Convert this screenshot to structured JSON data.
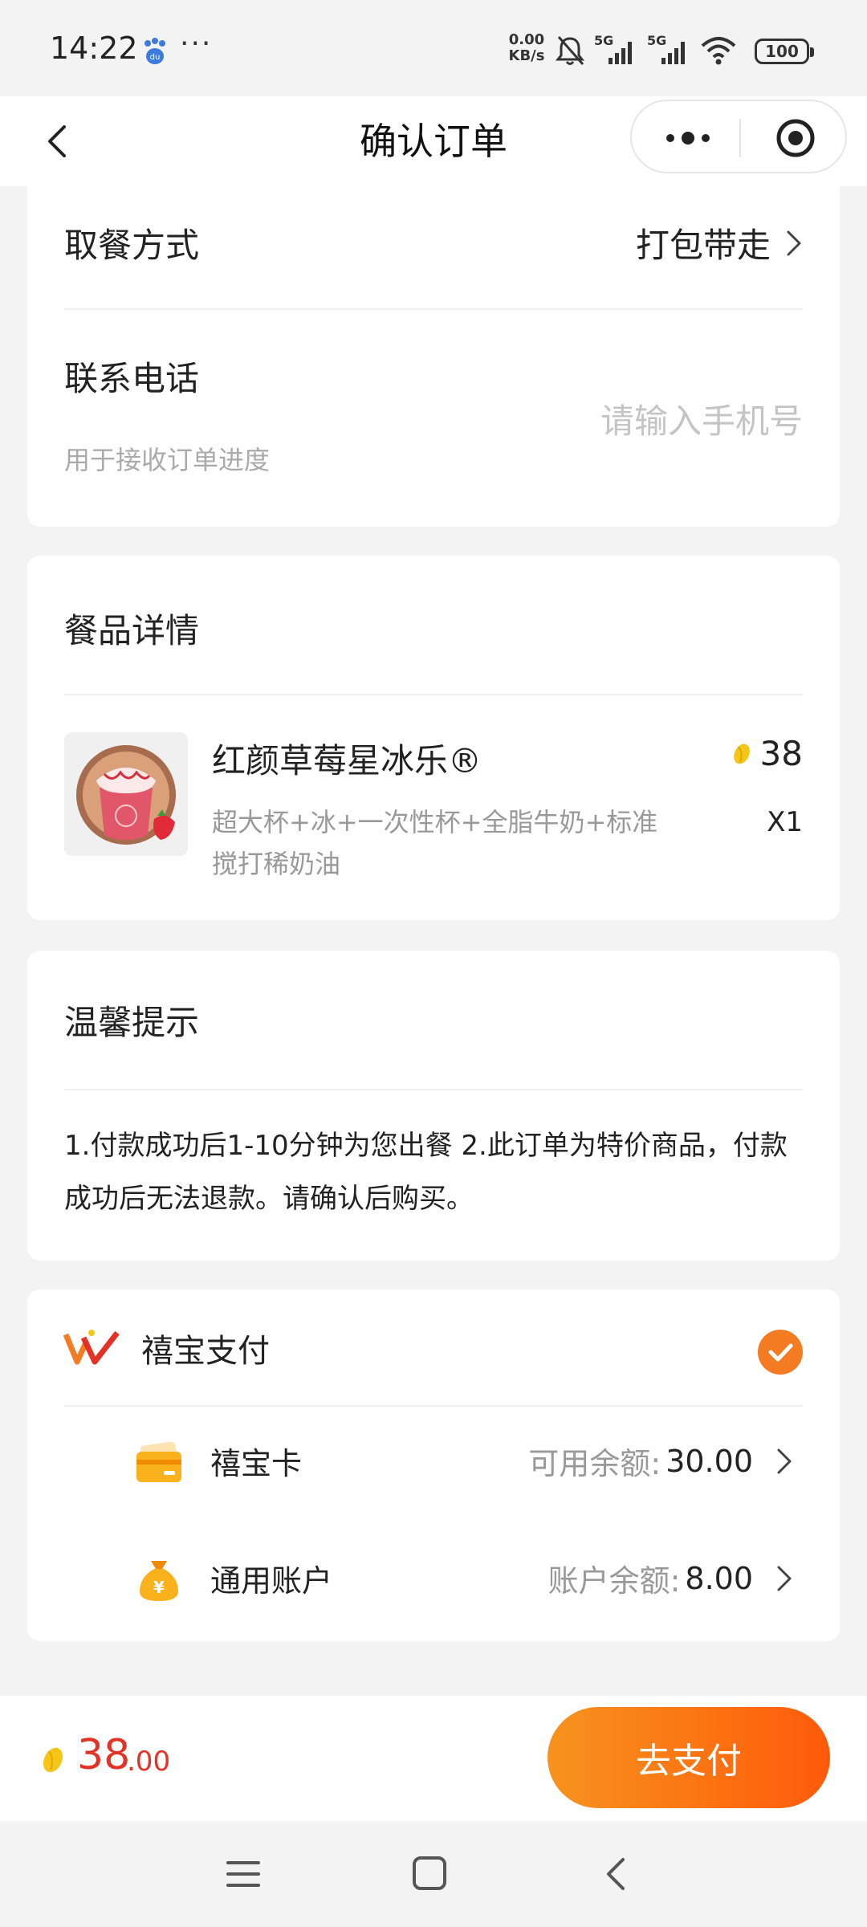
{
  "status_bar": {
    "time": "14:22",
    "more": "···",
    "net_speed_value": "0.00",
    "net_speed_unit": "KB/s",
    "signal_label": "5G",
    "battery": "100",
    "icons": [
      "baidu-paw-icon",
      "mute-bell-icon",
      "signal-5g-icon",
      "signal-5g-icon",
      "wifi-icon",
      "battery-icon"
    ]
  },
  "nav": {
    "title": "确认订单"
  },
  "order": {
    "pickup_label": "取餐方式",
    "pickup_value": "打包带走",
    "phone_label": "联系电话",
    "phone_hint": "用于接收订单进度",
    "phone_placeholder": "请输入手机号",
    "phone_value": ""
  },
  "items": {
    "section_title": "餐品详情",
    "list": [
      {
        "name": "红颜草莓星冰乐®",
        "desc": "超大杯+冰+一次性杯+全脂牛奶+标准搅打稀奶油",
        "price": "38",
        "qty": "X1"
      }
    ]
  },
  "tips": {
    "title": "温馨提示",
    "text": "1.付款成功后1-10分钟为您出餐 2.此订单为特价商品，付款成功后无法退款。请确认后购买。"
  },
  "payment": {
    "method": "禧宝支付",
    "selected": true,
    "accounts": [
      {
        "name": "禧宝卡",
        "balance_label": "可用余额:",
        "balance": "30.00",
        "icon": "card-icon"
      },
      {
        "name": "通用账户",
        "balance_label": "账户余额:",
        "balance": "8.00",
        "icon": "money-bag-icon"
      }
    ]
  },
  "bottom": {
    "total_int": "38",
    "total_dec": ".00",
    "pay_button": "去支付"
  },
  "colors": {
    "accent": "#f47b22",
    "price_red": "#e53226",
    "bean_yellow": "#f5c518"
  }
}
